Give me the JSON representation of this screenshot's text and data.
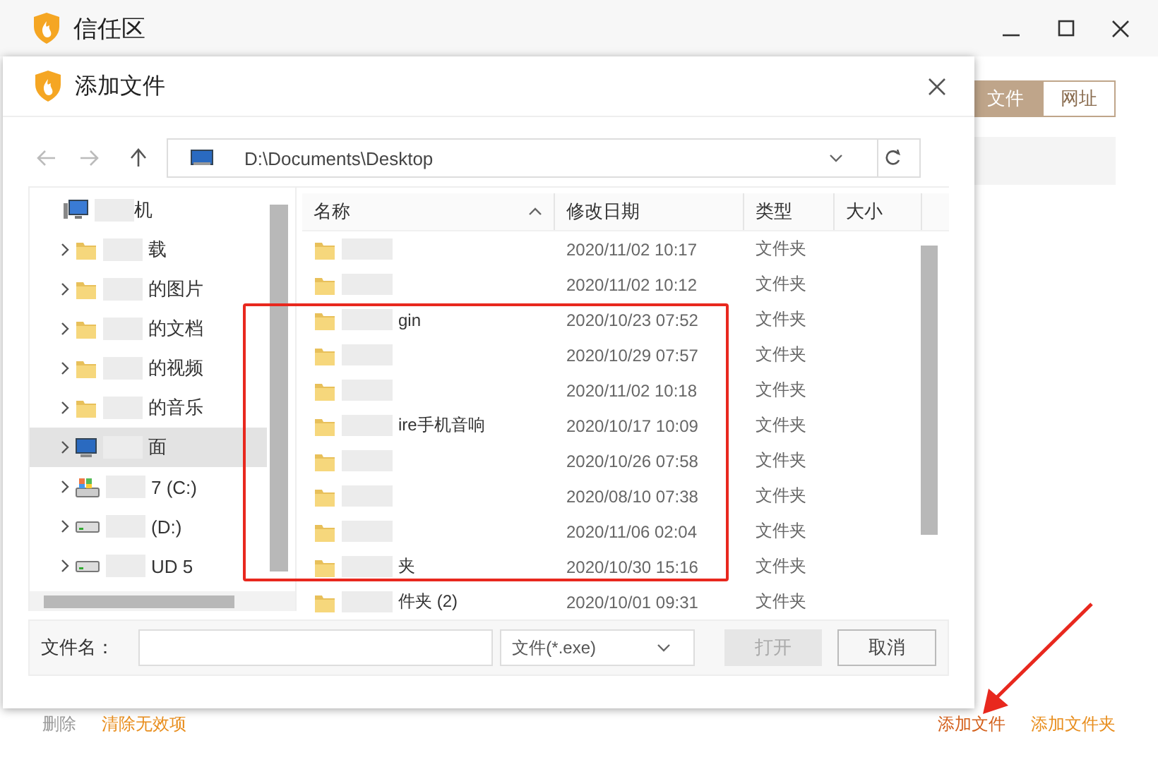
{
  "window": {
    "title": "信任区"
  },
  "mode_tabs": [
    {
      "label": "文件",
      "selected": true
    },
    {
      "label": "网址",
      "selected": false
    }
  ],
  "left_actions": [
    {
      "label": "删除",
      "disabled": true
    },
    {
      "label": "清除无效项",
      "disabled": false
    }
  ],
  "right_actions": [
    {
      "label": "添加文件"
    },
    {
      "label": "添加文件夹"
    }
  ],
  "dialog": {
    "title": "添加文件",
    "address": "D:\\Documents\\Desktop",
    "tree": [
      {
        "label": "机",
        "kind": "computer",
        "selected": false,
        "children": [
          {
            "label": "载",
            "kind": "folder",
            "selected": false
          },
          {
            "label": "的图片",
            "kind": "folder",
            "selected": false
          },
          {
            "label": "的文档",
            "kind": "folder",
            "selected": false
          },
          {
            "label": "的视频",
            "kind": "folder",
            "selected": false
          },
          {
            "label": "的音乐",
            "kind": "folder",
            "selected": false
          },
          {
            "label": "面",
            "kind": "desktop",
            "selected": true
          },
          {
            "label": "7 (C:)",
            "kind": "system-drive",
            "selected": false
          },
          {
            "label": "(D:)",
            "kind": "drive",
            "selected": false
          },
          {
            "label": "UD 5",
            "kind": "drive",
            "selected": false
          }
        ]
      }
    ],
    "columns": [
      {
        "label": "名称",
        "sorted": true
      },
      {
        "label": "修改日期",
        "sorted": false
      },
      {
        "label": "类型",
        "sorted": false
      },
      {
        "label": "大小",
        "sorted": false
      }
    ],
    "rows": [
      {
        "date": "2020/11/02 10:17",
        "type": "文件夹"
      },
      {
        "date": "2020/11/02 10:12",
        "type": "文件夹"
      },
      {
        "name": "gin",
        "date": "2020/10/23 07:52",
        "type": "文件夹"
      },
      {
        "date": "2020/10/29 07:57",
        "type": "文件夹"
      },
      {
        "date": "2020/11/02 10:18",
        "type": "文件夹"
      },
      {
        "name": "ire手机音响",
        "date": "2020/10/17 10:09",
        "type": "文件夹"
      },
      {
        "date": "2020/10/26 07:58",
        "type": "文件夹"
      },
      {
        "date": "2020/08/10 07:38",
        "type": "文件夹"
      },
      {
        "date": "2020/11/06 02:04",
        "type": "文件夹"
      },
      {
        "name": "夹",
        "date": "2020/10/30 15:16",
        "type": "文件夹"
      },
      {
        "name": "件夹 (2)",
        "date": "2020/10/01 09:31",
        "type": "文件夹"
      }
    ],
    "file_name_label": "文件名：",
    "filter": "文件(*.exe)",
    "buttons": [
      {
        "label": "打开",
        "disabled": true
      },
      {
        "label": "取消",
        "disabled": false
      }
    ]
  }
}
